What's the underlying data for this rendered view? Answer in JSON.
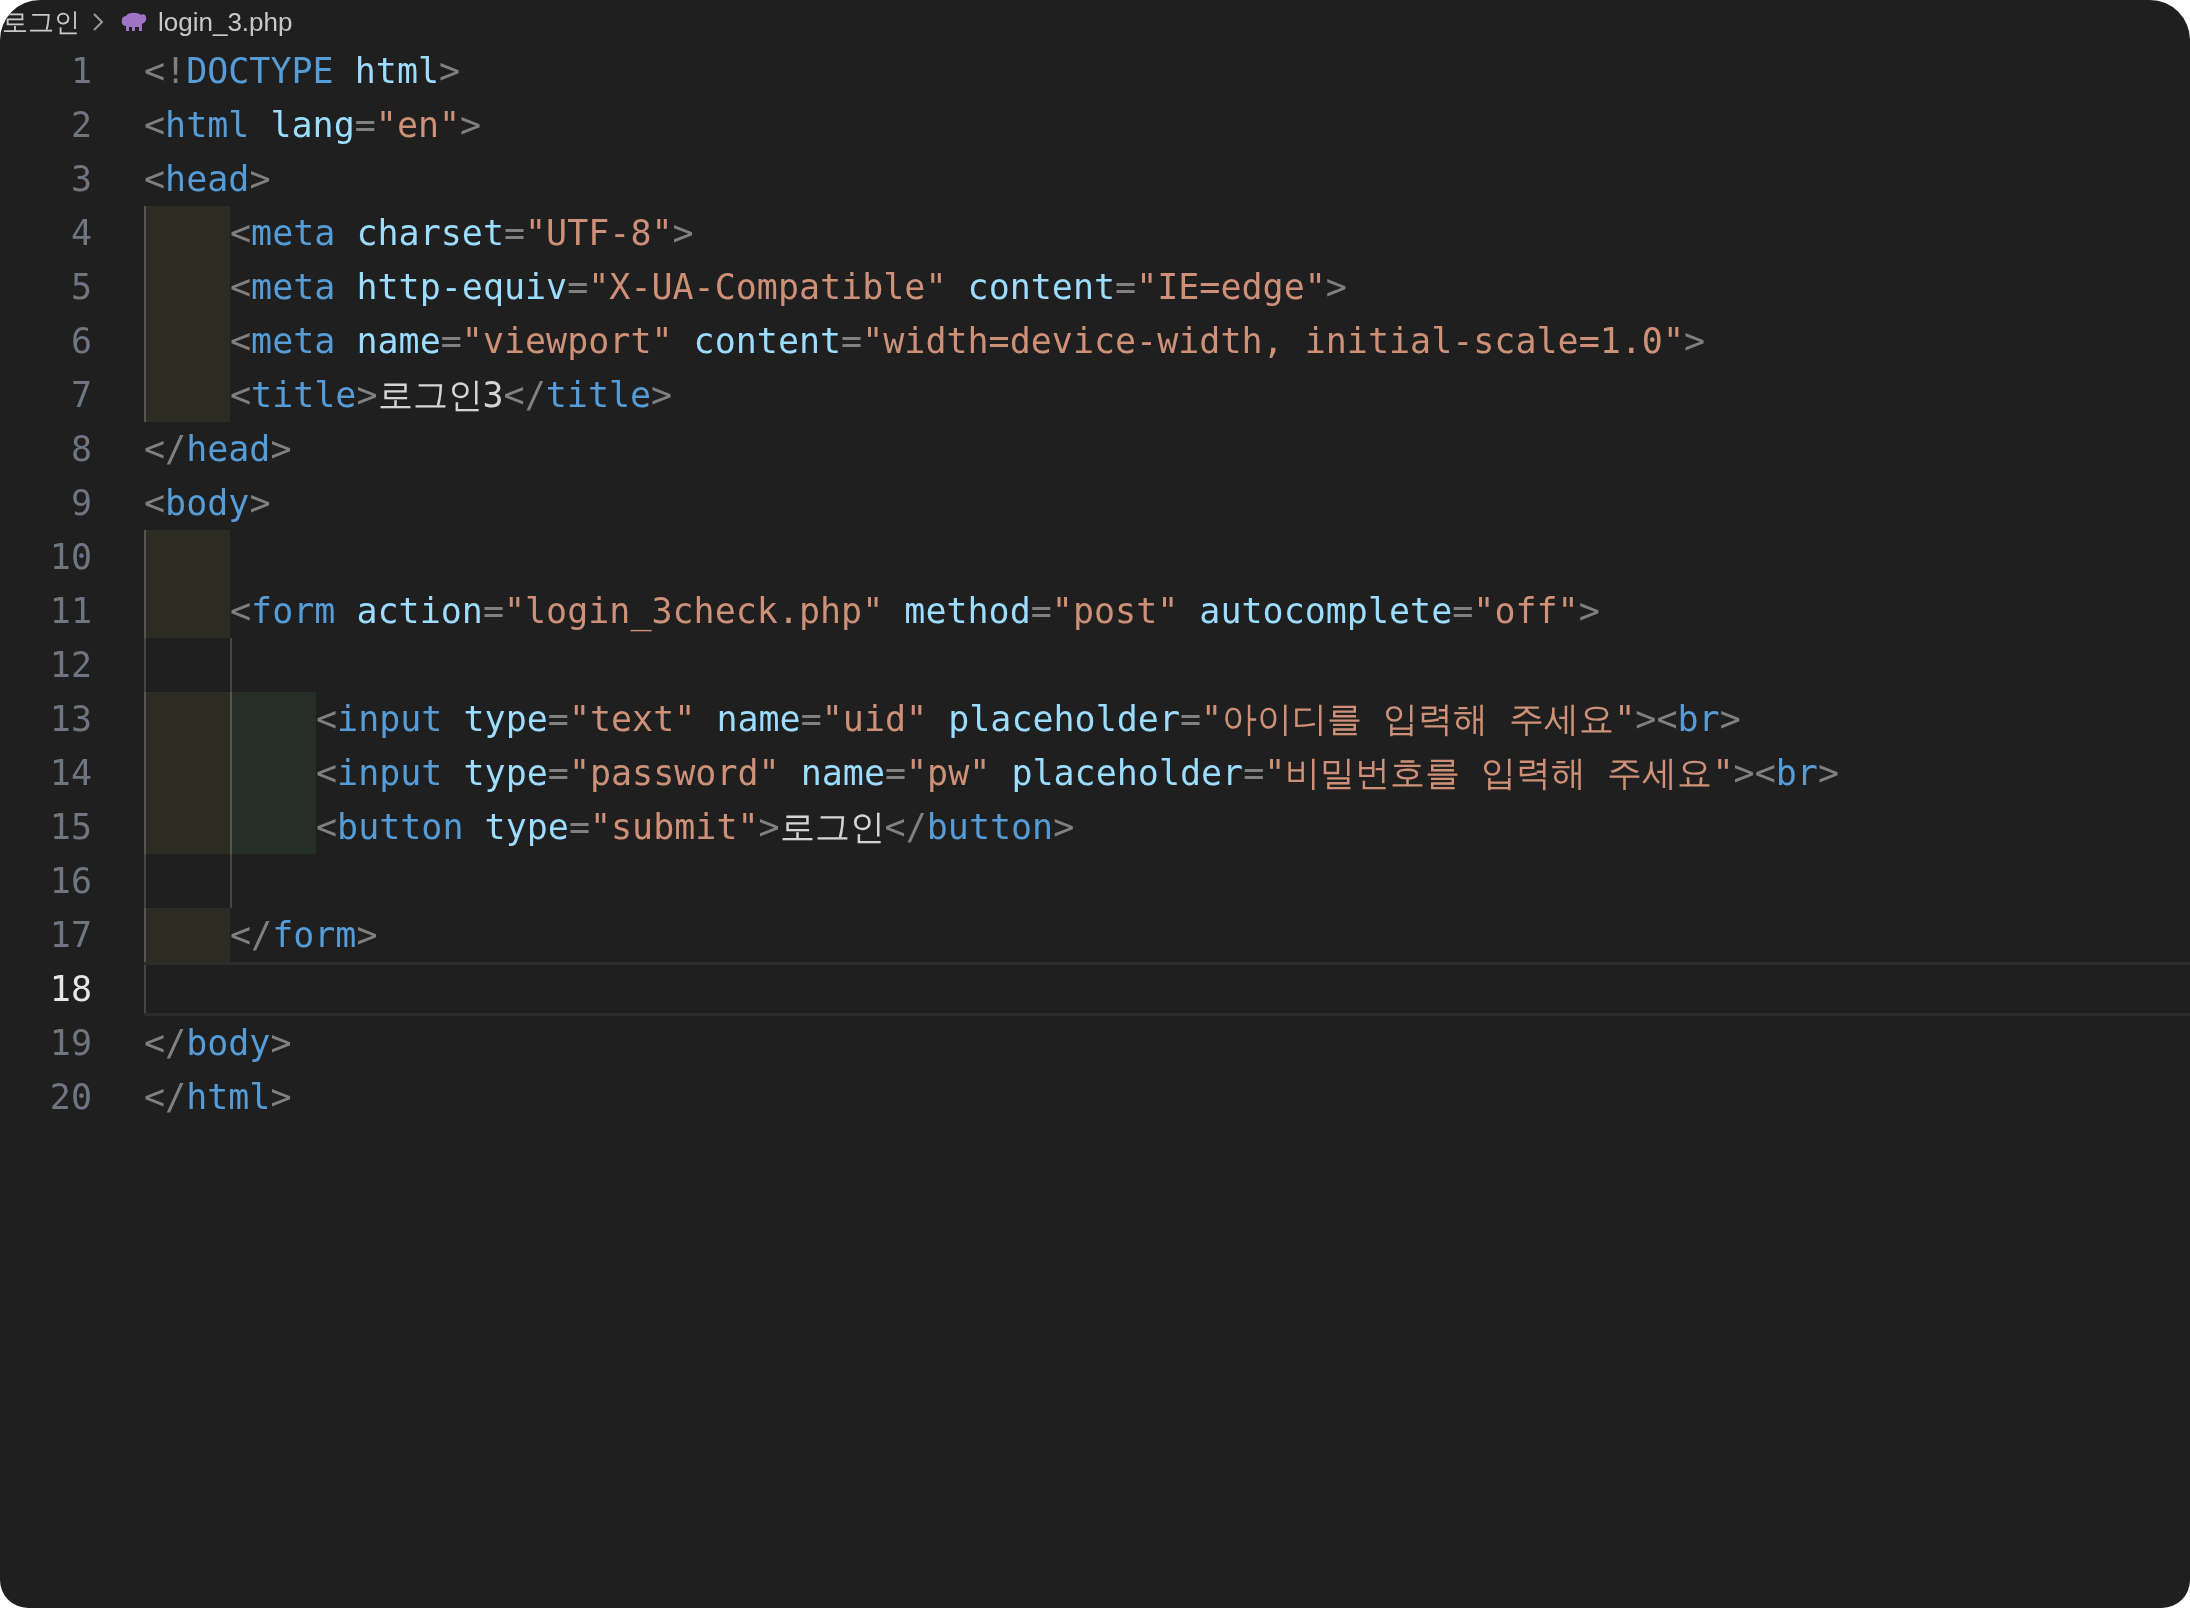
{
  "breadcrumb": {
    "folder": "로그인",
    "file": "login_3.php"
  },
  "lines": [
    {
      "number": "1",
      "selected": false,
      "tokens": [
        {
          "kind": "punct",
          "text": "<!"
        },
        {
          "kind": "tag",
          "text": "DOCTYPE"
        },
        {
          "kind": "attr",
          "text": " html"
        },
        {
          "kind": "punct",
          "text": ">"
        }
      ]
    },
    {
      "number": "2",
      "selected": false,
      "tokens": [
        {
          "kind": "punct",
          "text": "<"
        },
        {
          "kind": "tag",
          "text": "html"
        },
        {
          "kind": "attr",
          "text": " lang"
        },
        {
          "kind": "punct",
          "text": "="
        },
        {
          "kind": "string",
          "text": "\"en\""
        },
        {
          "kind": "punct",
          "text": ">"
        }
      ]
    },
    {
      "number": "3",
      "selected": false,
      "tokens": [
        {
          "kind": "punct",
          "text": "<"
        },
        {
          "kind": "tag",
          "text": "head"
        },
        {
          "kind": "punct",
          "text": ">"
        }
      ]
    },
    {
      "number": "4",
      "selected": false,
      "indent": [
        {
          "kind": "highlight"
        }
      ],
      "tokens": [
        {
          "kind": "punct",
          "text": "<"
        },
        {
          "kind": "tag",
          "text": "meta"
        },
        {
          "kind": "attr",
          "text": " charset"
        },
        {
          "kind": "punct",
          "text": "="
        },
        {
          "kind": "string",
          "text": "\"UTF-8\""
        },
        {
          "kind": "punct",
          "text": ">"
        }
      ]
    },
    {
      "number": "5",
      "selected": false,
      "indent": [
        {
          "kind": "highlight"
        }
      ],
      "tokens": [
        {
          "kind": "punct",
          "text": "<"
        },
        {
          "kind": "tag",
          "text": "meta"
        },
        {
          "kind": "attr",
          "text": " http-equiv"
        },
        {
          "kind": "punct",
          "text": "="
        },
        {
          "kind": "string",
          "text": "\"X-UA-Compatible\""
        },
        {
          "kind": "attr",
          "text": " content"
        },
        {
          "kind": "punct",
          "text": "="
        },
        {
          "kind": "string",
          "text": "\"IE=edge\""
        },
        {
          "kind": "punct",
          "text": ">"
        }
      ]
    },
    {
      "number": "6",
      "selected": false,
      "indent": [
        {
          "kind": "highlight"
        }
      ],
      "tokens": [
        {
          "kind": "punct",
          "text": "<"
        },
        {
          "kind": "tag",
          "text": "meta"
        },
        {
          "kind": "attr",
          "text": " name"
        },
        {
          "kind": "punct",
          "text": "="
        },
        {
          "kind": "string",
          "text": "\"viewport\""
        },
        {
          "kind": "attr",
          "text": " content"
        },
        {
          "kind": "punct",
          "text": "="
        },
        {
          "kind": "string",
          "text": "\"width=device-width, initial-scale=1.0\""
        },
        {
          "kind": "punct",
          "text": ">"
        }
      ]
    },
    {
      "number": "7",
      "selected": false,
      "indent": [
        {
          "kind": "highlight"
        }
      ],
      "tokens": [
        {
          "kind": "punct",
          "text": "<"
        },
        {
          "kind": "tag",
          "text": "title"
        },
        {
          "kind": "punct",
          "text": ">"
        },
        {
          "kind": "text",
          "text": "로그인3"
        },
        {
          "kind": "punct",
          "text": "</"
        },
        {
          "kind": "tag",
          "text": "title"
        },
        {
          "kind": "punct",
          "text": ">"
        }
      ]
    },
    {
      "number": "8",
      "selected": false,
      "tokens": [
        {
          "kind": "punct",
          "text": "</"
        },
        {
          "kind": "tag",
          "text": "head"
        },
        {
          "kind": "punct",
          "text": ">"
        }
      ]
    },
    {
      "number": "9",
      "selected": false,
      "tokens": [
        {
          "kind": "punct",
          "text": "<"
        },
        {
          "kind": "tag",
          "text": "body"
        },
        {
          "kind": "punct",
          "text": ">"
        }
      ]
    },
    {
      "number": "10",
      "selected": false,
      "indent": [
        {
          "kind": "highlight"
        }
      ]
    },
    {
      "number": "11",
      "selected": false,
      "indent": [
        {
          "kind": "highlight"
        }
      ],
      "tokens": [
        {
          "kind": "punct",
          "text": "<"
        },
        {
          "kind": "tag",
          "text": "form"
        },
        {
          "kind": "attr",
          "text": " action"
        },
        {
          "kind": "punct",
          "text": "="
        },
        {
          "kind": "string",
          "text": "\"login_3check.php\""
        },
        {
          "kind": "attr",
          "text": " method"
        },
        {
          "kind": "punct",
          "text": "="
        },
        {
          "kind": "string",
          "text": "\"post\""
        },
        {
          "kind": "attr",
          "text": " autocomplete"
        },
        {
          "kind": "punct",
          "text": "="
        },
        {
          "kind": "string",
          "text": "\"off\""
        },
        {
          "kind": "punct",
          "text": ">"
        }
      ]
    },
    {
      "number": "12",
      "selected": false,
      "indent": [
        {
          "kind": "guide"
        },
        {
          "kind": "guide"
        }
      ]
    },
    {
      "number": "13",
      "selected": false,
      "indent": [
        {
          "kind": "highlight"
        },
        {
          "kind": "highlight"
        }
      ],
      "tokens": [
        {
          "kind": "punct",
          "text": "<"
        },
        {
          "kind": "tag",
          "text": "input"
        },
        {
          "kind": "attr",
          "text": " type"
        },
        {
          "kind": "punct",
          "text": "="
        },
        {
          "kind": "string",
          "text": "\"text\""
        },
        {
          "kind": "attr",
          "text": " name"
        },
        {
          "kind": "punct",
          "text": "="
        },
        {
          "kind": "string",
          "text": "\"uid\""
        },
        {
          "kind": "attr",
          "text": " placeholder"
        },
        {
          "kind": "punct",
          "text": "="
        },
        {
          "kind": "string",
          "text": "\"아이디를 입력해 주세요\""
        },
        {
          "kind": "punct",
          "text": "><"
        },
        {
          "kind": "tag",
          "text": "br"
        },
        {
          "kind": "punct",
          "text": ">"
        }
      ]
    },
    {
      "number": "14",
      "selected": false,
      "indent": [
        {
          "kind": "highlight"
        },
        {
          "kind": "highlight"
        }
      ],
      "tokens": [
        {
          "kind": "punct",
          "text": "<"
        },
        {
          "kind": "tag",
          "text": "input"
        },
        {
          "kind": "attr",
          "text": " type"
        },
        {
          "kind": "punct",
          "text": "="
        },
        {
          "kind": "string",
          "text": "\"password\""
        },
        {
          "kind": "attr",
          "text": " name"
        },
        {
          "kind": "punct",
          "text": "="
        },
        {
          "kind": "string",
          "text": "\"pw\""
        },
        {
          "kind": "attr",
          "text": " placeholder"
        },
        {
          "kind": "punct",
          "text": "="
        },
        {
          "kind": "string",
          "text": "\"비밀번호를 입력해 주세요\""
        },
        {
          "kind": "punct",
          "text": "><"
        },
        {
          "kind": "tag",
          "text": "br"
        },
        {
          "kind": "punct",
          "text": ">"
        }
      ]
    },
    {
      "number": "15",
      "selected": false,
      "indent": [
        {
          "kind": "highlight"
        },
        {
          "kind": "highlight"
        }
      ],
      "tokens": [
        {
          "kind": "punct",
          "text": "<"
        },
        {
          "kind": "tag",
          "text": "button"
        },
        {
          "kind": "attr",
          "text": " type"
        },
        {
          "kind": "punct",
          "text": "="
        },
        {
          "kind": "string",
          "text": "\"submit\""
        },
        {
          "kind": "punct",
          "text": ">"
        },
        {
          "kind": "text",
          "text": "로그인"
        },
        {
          "kind": "punct",
          "text": "</"
        },
        {
          "kind": "tag",
          "text": "button"
        },
        {
          "kind": "punct",
          "text": ">"
        }
      ]
    },
    {
      "number": "16",
      "selected": false,
      "indent": [
        {
          "kind": "guide"
        },
        {
          "kind": "guide"
        }
      ]
    },
    {
      "number": "17",
      "selected": false,
      "indent": [
        {
          "kind": "highlight"
        }
      ],
      "tokens": [
        {
          "kind": "punct",
          "text": "</"
        },
        {
          "kind": "tag",
          "text": "form"
        },
        {
          "kind": "punct",
          "text": ">"
        }
      ]
    },
    {
      "number": "18",
      "selected": true,
      "indent": [
        {
          "kind": "guide"
        }
      ]
    },
    {
      "number": "19",
      "selected": false,
      "tokens": [
        {
          "kind": "punct",
          "text": "</"
        },
        {
          "kind": "tag",
          "text": "body"
        },
        {
          "kind": "punct",
          "text": ">"
        }
      ]
    },
    {
      "number": "20",
      "selected": false,
      "tokens": [
        {
          "kind": "punct",
          "text": "</"
        },
        {
          "kind": "tag",
          "text": "html"
        },
        {
          "kind": "punct",
          "text": ">"
        }
      ]
    }
  ]
}
